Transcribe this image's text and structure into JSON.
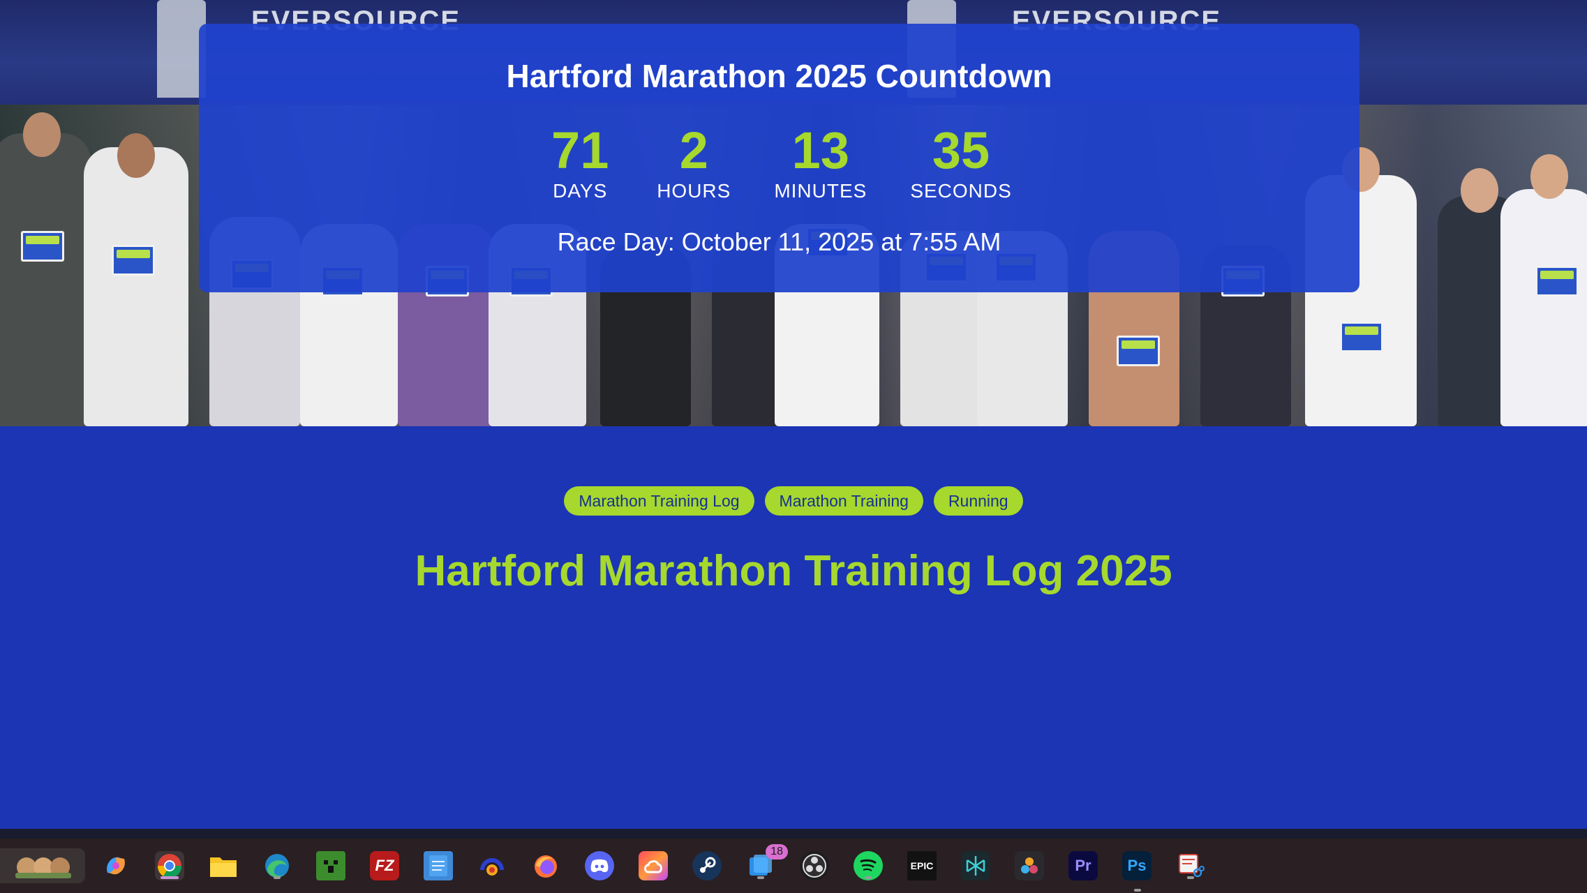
{
  "hero": {
    "banner_text": "EVERSOURCE",
    "countdown": {
      "title": "Hartford Marathon 2025 Countdown",
      "days": "71",
      "days_label": "DAYS",
      "hours": "2",
      "hours_label": "HOURS",
      "minutes": "13",
      "minutes_label": "MINUTES",
      "seconds": "35",
      "seconds_label": "SECONDS",
      "race_day": "Race Day: October 11, 2025 at 7:55 AM"
    }
  },
  "tags": [
    "Marathon Training Log",
    "Marathon Training",
    "Running"
  ],
  "page_title": "Hartford Marathon Training Log 2025",
  "colors": {
    "background": "#1b35b4",
    "accent_green": "#a6d82e",
    "card_blue": "#1f42cd"
  },
  "taskbar": {
    "icons": [
      {
        "name": "widgets-icon",
        "label": ""
      },
      {
        "name": "copilot-icon",
        "label": ""
      },
      {
        "name": "chrome-icon",
        "label": ""
      },
      {
        "name": "file-explorer-icon",
        "label": ""
      },
      {
        "name": "edge-icon",
        "label": ""
      },
      {
        "name": "minecraft-icon",
        "label": ""
      },
      {
        "name": "filezilla-icon",
        "label": "FZ"
      },
      {
        "name": "notepad-icon",
        "label": ""
      },
      {
        "name": "audio-app-icon",
        "label": ""
      },
      {
        "name": "firefox-icon",
        "label": ""
      },
      {
        "name": "discord-icon",
        "label": ""
      },
      {
        "name": "creative-cloud-icon",
        "label": ""
      },
      {
        "name": "steam-icon",
        "label": ""
      },
      {
        "name": "windows-app-icon",
        "label": "",
        "badge": "18"
      },
      {
        "name": "obs-icon",
        "label": ""
      },
      {
        "name": "spotify-icon",
        "label": ""
      },
      {
        "name": "epic-games-icon",
        "label": "EPIC"
      },
      {
        "name": "perplexity-icon",
        "label": ""
      },
      {
        "name": "davinci-resolve-icon",
        "label": ""
      },
      {
        "name": "premiere-pro-icon",
        "label": "Pr"
      },
      {
        "name": "photoshop-icon",
        "label": "Ps"
      },
      {
        "name": "snipping-tool-icon",
        "label": ""
      }
    ]
  }
}
